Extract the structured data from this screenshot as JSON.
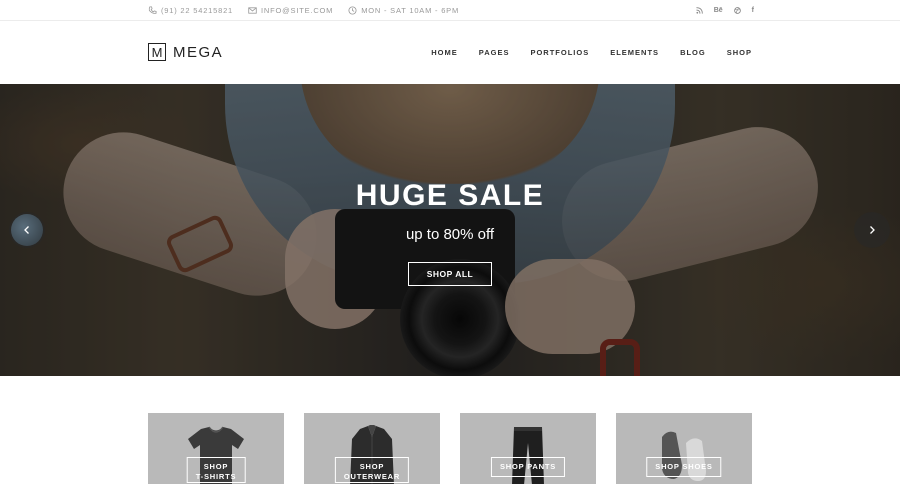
{
  "topbar": {
    "phone": "(91) 22 54215821",
    "email": "INFO@SITE.COM",
    "hours": "MON - SAT 10AM - 6PM",
    "social": [
      "rss-icon",
      "behance-icon",
      "dribbble-icon",
      "facebook-icon"
    ],
    "social_labels": [
      "",
      "Bē",
      "",
      "f"
    ]
  },
  "header": {
    "logo_letter": "M",
    "logo_name": "MEGA",
    "nav": [
      "HOME",
      "PAGES",
      "PORTFOLIOS",
      "ELEMENTS",
      "BLOG",
      "SHOP"
    ]
  },
  "hero": {
    "title": "HUGE SALE",
    "subtitle": "up to 80% off",
    "button": "SHOP ALL"
  },
  "products": [
    {
      "line1": "SHOP",
      "line2": "T-SHIRTS"
    },
    {
      "line1": "SHOP",
      "line2": "OUTERWEAR"
    },
    {
      "line1": "SHOP PANTS",
      "line2": ""
    },
    {
      "line1": "SHOP SHOES",
      "line2": ""
    }
  ],
  "colors": {
    "accent_text": "#333333",
    "card_bg": "#b9b9b9",
    "muted": "#999999"
  }
}
